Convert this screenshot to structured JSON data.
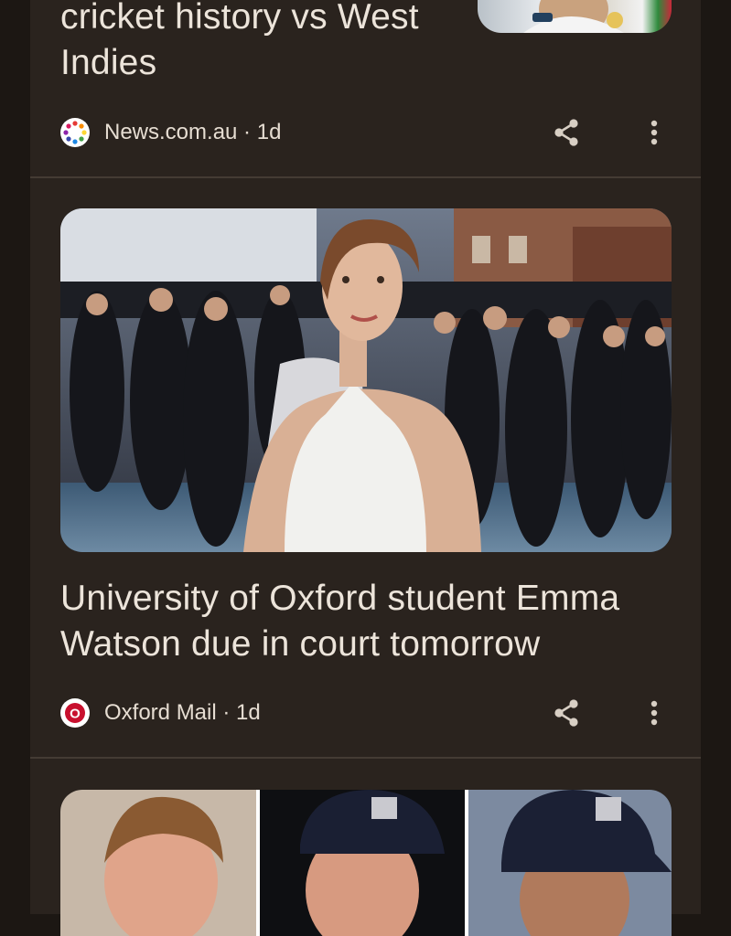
{
  "cards": [
    {
      "headline_lines": [
        "cricket history vs West",
        "Indies"
      ],
      "source": "News.com.au",
      "age": "1d",
      "logo_icon": "news-com-au-dots-icon"
    },
    {
      "headline_lines": [
        "University of Oxford student Emma",
        "Watson due in court tomorrow"
      ],
      "source": "Oxford Mail",
      "age": "1d",
      "logo_icon": "oxford-mail-logo-icon",
      "logo_letter": "O"
    }
  ],
  "separator": " · ",
  "colors": {
    "background": "#1c1713",
    "card": "#2a231e",
    "divider": "#443b34",
    "text": "#ece4da",
    "oxford_red": "#c8102e"
  }
}
